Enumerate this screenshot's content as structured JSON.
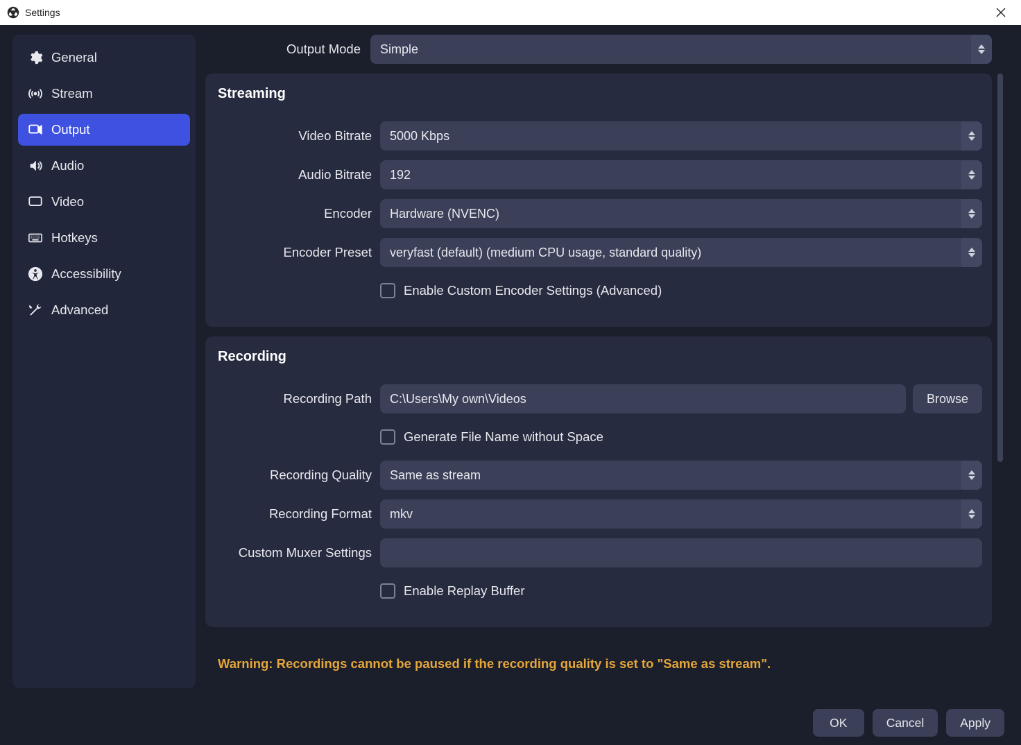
{
  "window": {
    "title": "Settings"
  },
  "sidebar": {
    "items": [
      {
        "label": "General"
      },
      {
        "label": "Stream"
      },
      {
        "label": "Output"
      },
      {
        "label": "Audio"
      },
      {
        "label": "Video"
      },
      {
        "label": "Hotkeys"
      },
      {
        "label": "Accessibility"
      },
      {
        "label": "Advanced"
      }
    ]
  },
  "output_mode": {
    "label": "Output Mode",
    "value": "Simple"
  },
  "streaming": {
    "title": "Streaming",
    "video_bitrate": {
      "label": "Video Bitrate",
      "value": "5000 Kbps"
    },
    "audio_bitrate": {
      "label": "Audio Bitrate",
      "value": "192"
    },
    "encoder": {
      "label": "Encoder",
      "value": "Hardware (NVENC)"
    },
    "encoder_preset": {
      "label": "Encoder Preset",
      "value": "veryfast (default) (medium CPU usage, standard quality)"
    },
    "enable_custom": {
      "label": "Enable Custom Encoder Settings (Advanced)"
    }
  },
  "recording": {
    "title": "Recording",
    "path": {
      "label": "Recording Path",
      "value": "C:\\Users\\My own\\Videos",
      "browse": "Browse"
    },
    "no_space": {
      "label": "Generate File Name without Space"
    },
    "quality": {
      "label": "Recording Quality",
      "value": "Same as stream"
    },
    "format": {
      "label": "Recording Format",
      "value": "mkv"
    },
    "muxer": {
      "label": "Custom Muxer Settings",
      "value": ""
    },
    "replay_buffer": {
      "label": "Enable Replay Buffer"
    }
  },
  "warning": "Warning: Recordings cannot be paused if the recording quality is set to \"Same as stream\".",
  "footer": {
    "ok": "OK",
    "cancel": "Cancel",
    "apply": "Apply"
  }
}
